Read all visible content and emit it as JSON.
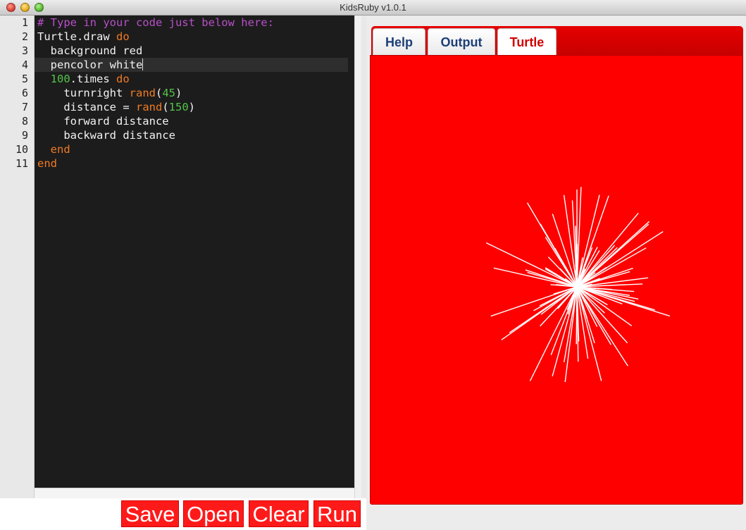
{
  "window": {
    "title": "KidsRuby v1.0.1"
  },
  "editor": {
    "active_line": 4,
    "lines": [
      {
        "num": "1",
        "tokens": [
          {
            "t": "# Type in your code just below here:",
            "c": "comment"
          }
        ]
      },
      {
        "num": "2",
        "tokens": [
          {
            "t": "Turtle.draw ",
            "c": "plain"
          },
          {
            "t": "do",
            "c": "kw"
          }
        ]
      },
      {
        "num": "3",
        "tokens": [
          {
            "t": "  background red",
            "c": "plain"
          }
        ]
      },
      {
        "num": "4",
        "tokens": [
          {
            "t": "  pencolor white",
            "c": "plain"
          }
        ]
      },
      {
        "num": "5",
        "tokens": [
          {
            "t": "  ",
            "c": "plain"
          },
          {
            "t": "100",
            "c": "num"
          },
          {
            "t": ".times ",
            "c": "plain"
          },
          {
            "t": "do",
            "c": "kw"
          }
        ]
      },
      {
        "num": "6",
        "tokens": [
          {
            "t": "    turnright ",
            "c": "plain"
          },
          {
            "t": "rand",
            "c": "kw"
          },
          {
            "t": "(",
            "c": "plain"
          },
          {
            "t": "45",
            "c": "num"
          },
          {
            "t": ")",
            "c": "plain"
          }
        ]
      },
      {
        "num": "7",
        "tokens": [
          {
            "t": "    distance = ",
            "c": "plain"
          },
          {
            "t": "rand",
            "c": "kw"
          },
          {
            "t": "(",
            "c": "plain"
          },
          {
            "t": "150",
            "c": "num"
          },
          {
            "t": ")",
            "c": "plain"
          }
        ]
      },
      {
        "num": "8",
        "tokens": [
          {
            "t": "    forward distance",
            "c": "plain"
          }
        ]
      },
      {
        "num": "9",
        "tokens": [
          {
            "t": "    backward distance",
            "c": "plain"
          }
        ]
      },
      {
        "num": "10",
        "tokens": [
          {
            "t": "  ",
            "c": "plain"
          },
          {
            "t": "end",
            "c": "kw"
          }
        ]
      },
      {
        "num": "11",
        "tokens": [
          {
            "t": "end",
            "c": "kw"
          }
        ]
      }
    ]
  },
  "buttons": {
    "save": "Save",
    "open": "Open",
    "clear": "Clear",
    "run": "Run"
  },
  "tabs": [
    {
      "label": "Help",
      "active": false
    },
    {
      "label": "Output",
      "active": false
    },
    {
      "label": "Turtle",
      "active": true
    }
  ],
  "colors": {
    "canvas_background": "#ff0000",
    "pen": "#ffffff",
    "button": "#ff1a1a",
    "tab_inactive_text": "#1c3f78",
    "tab_active_text": "#d10000",
    "comment": "#b84fc9",
    "keyword": "#f07b24",
    "number": "#55c34a"
  }
}
